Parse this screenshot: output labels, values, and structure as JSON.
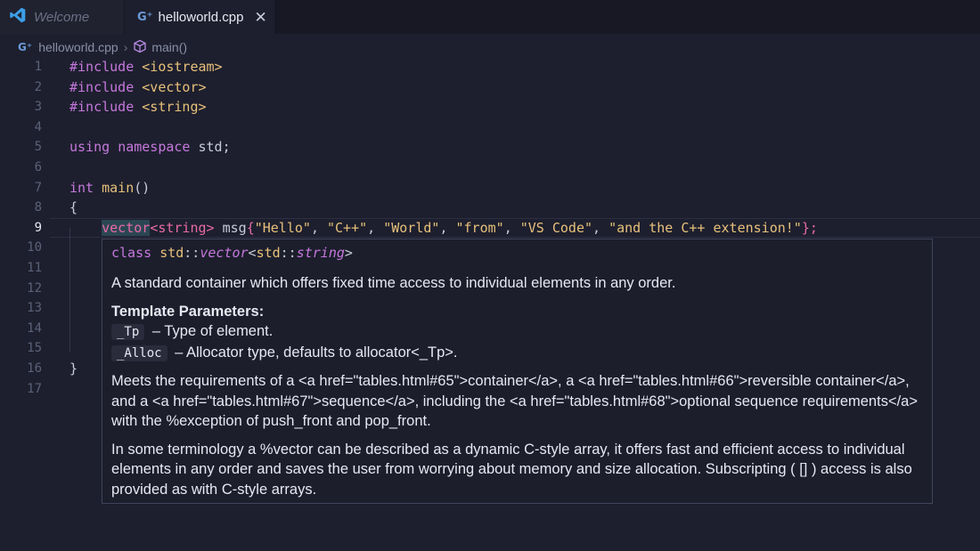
{
  "tabs": [
    {
      "label": "Welcome",
      "active": false,
      "icon": "vscode-logo-icon"
    },
    {
      "label": "helloworld.cpp",
      "active": true,
      "icon": "cpp-file-icon"
    }
  ],
  "breadcrumb": {
    "file": "helloworld.cpp",
    "symbol": "main()"
  },
  "editor": {
    "line_numbers": [
      "1",
      "2",
      "3",
      "4",
      "5",
      "6",
      "7",
      "8",
      "9",
      "10",
      "11",
      "12",
      "13",
      "14",
      "15",
      "16",
      "17"
    ],
    "active_line": 9,
    "lines": {
      "l1": {
        "kw": "#include",
        "arg": "<iostream>"
      },
      "l2": {
        "kw": "#include",
        "arg": "<vector>"
      },
      "l3": {
        "kw": "#include",
        "arg": "<string>"
      },
      "l5": {
        "kw1": "using",
        "kw2": "namespace",
        "name": "std;"
      },
      "l7": {
        "type": "int",
        "fn": "main",
        "paren": "()"
      },
      "l8": "{",
      "l9": {
        "vector": "vector",
        "tmpl": "<string>",
        "var": "msg",
        "open": "{",
        "s1": "\"Hello\"",
        "s2": "\"C++\"",
        "s3": "\"World\"",
        "s4": "\"from\"",
        "s5": "\"VS Code\"",
        "s6": "\"and the C++ extension!\"",
        "close": "};",
        "comma": ", "
      },
      "l16": "}"
    }
  },
  "hover": {
    "sig_class": "class",
    "sig_ns": "std",
    "sig_sep": "::",
    "sig_vector": "vector",
    "sig_lt": "<",
    "sig_ns2": "std",
    "sig_sep2": "::",
    "sig_string": "string",
    "sig_gt": ">",
    "description": "A standard container which offers fixed time access to individual elements in any order.",
    "template_title": "Template Parameters:",
    "params": [
      {
        "name": "_Tp",
        "desc": " – Type of element."
      },
      {
        "name": "_Alloc",
        "desc": " – Allocator type, defaults to allocator<_Tp>."
      }
    ],
    "requirements": "Meets the requirements of a <a href=\"tables.html#65\">container</a>, a <a href=\"tables.html#66\">reversible container</a>, and a <a href=\"tables.html#67\">sequence</a>, including the <a href=\"tables.html#68\">optional sequence requirements</a> with the %exception of push_front and pop_front.",
    "terminology": "In some terminology a %vector can be described as a dynamic C-style array, it offers fast and efficient access to individual elements in any order and saves the user from worrying about memory and size allocation. Subscripting ( [] ) access is also provided as with C-style arrays."
  },
  "colors": {
    "background": "#1d1f2e",
    "keyword": "#c678dd",
    "string": "#e8c07a",
    "template": "#e86aa5"
  }
}
